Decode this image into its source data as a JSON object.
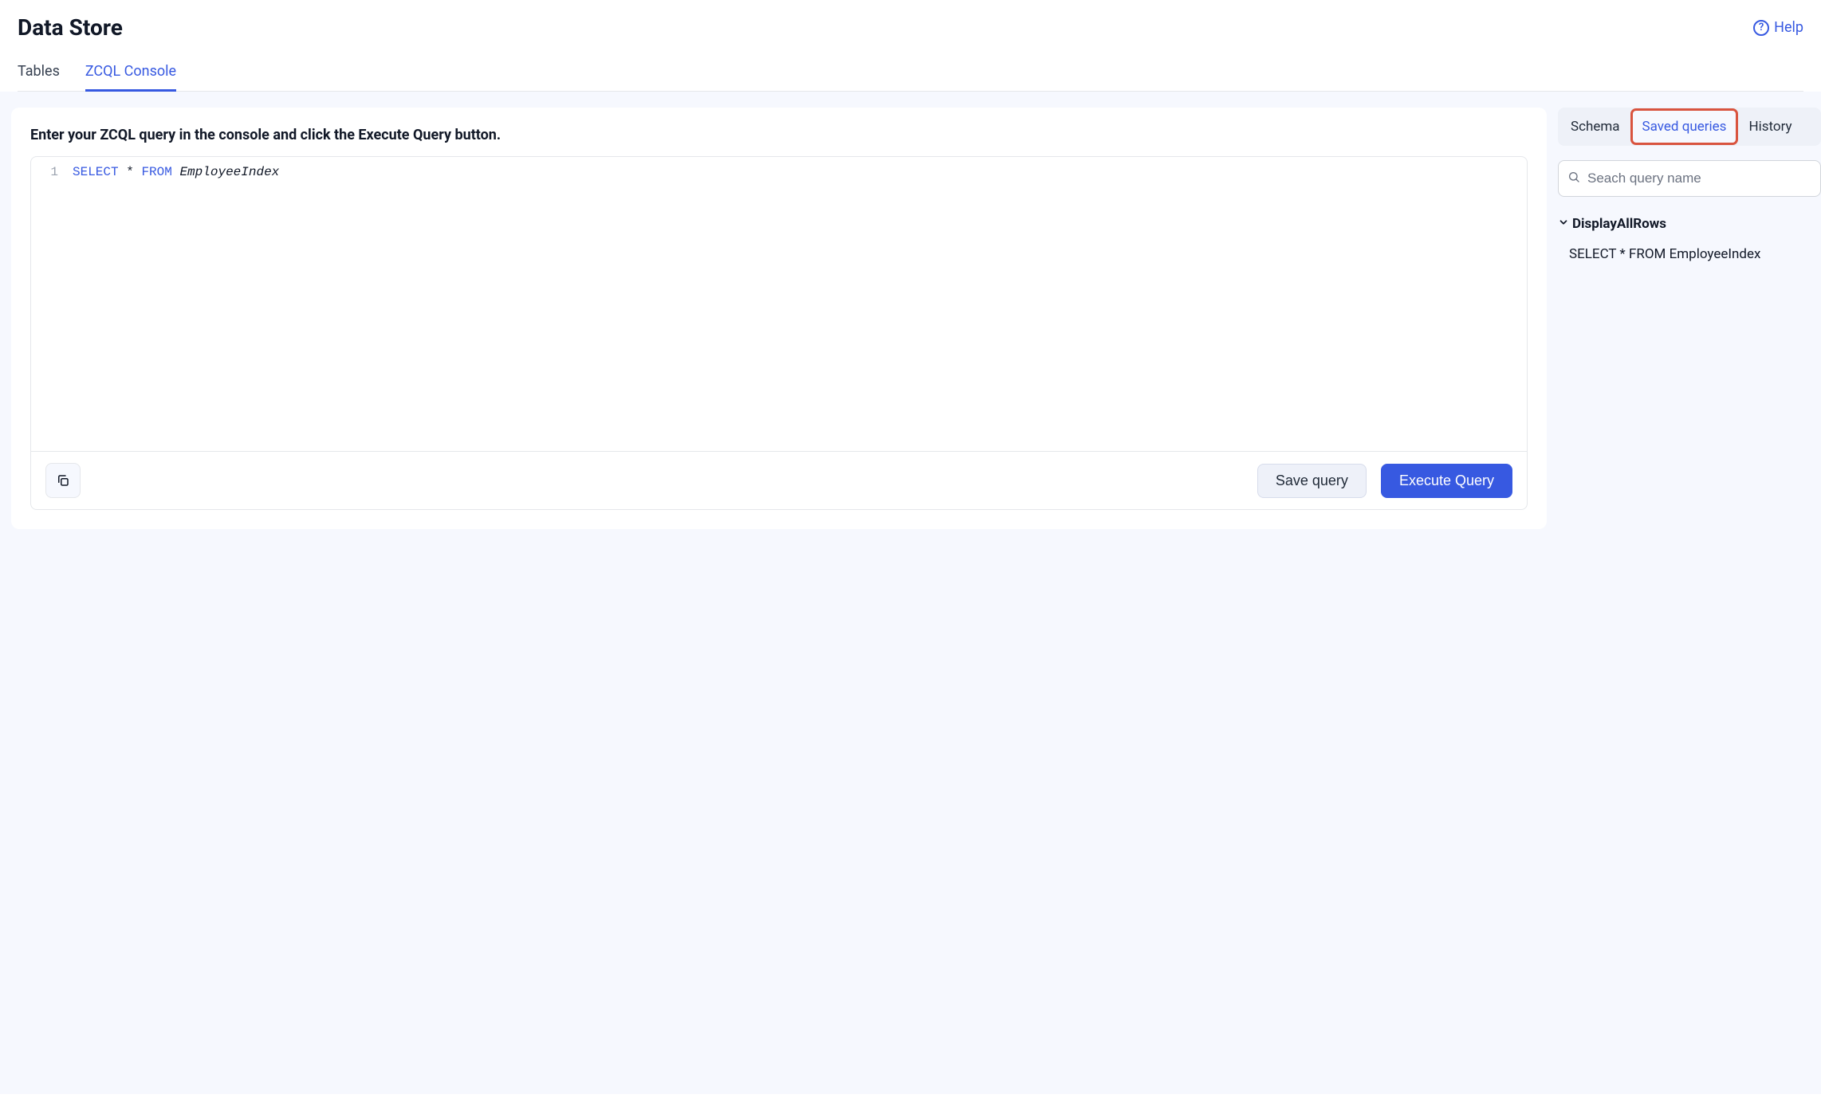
{
  "header": {
    "title": "Data Store",
    "help_label": "Help"
  },
  "main_tabs": {
    "tables": "Tables",
    "zcql_console": "ZCQL Console"
  },
  "editor": {
    "prompt": "Enter your ZCQL query in the console and click the Execute Query button.",
    "line_number": "1",
    "query_kw_select": "SELECT",
    "query_star": "*",
    "query_kw_from": "FROM",
    "query_ident": "EmployeeIndex"
  },
  "buttons": {
    "save_query": "Save query",
    "execute_query": "Execute Query"
  },
  "side": {
    "tabs": {
      "schema": "Schema",
      "saved_queries": "Saved queries",
      "history": "History"
    },
    "search_placeholder": "Seach query name",
    "saved": {
      "name": "DisplayAllRows",
      "body": "SELECT * FROM EmployeeIndex"
    }
  }
}
